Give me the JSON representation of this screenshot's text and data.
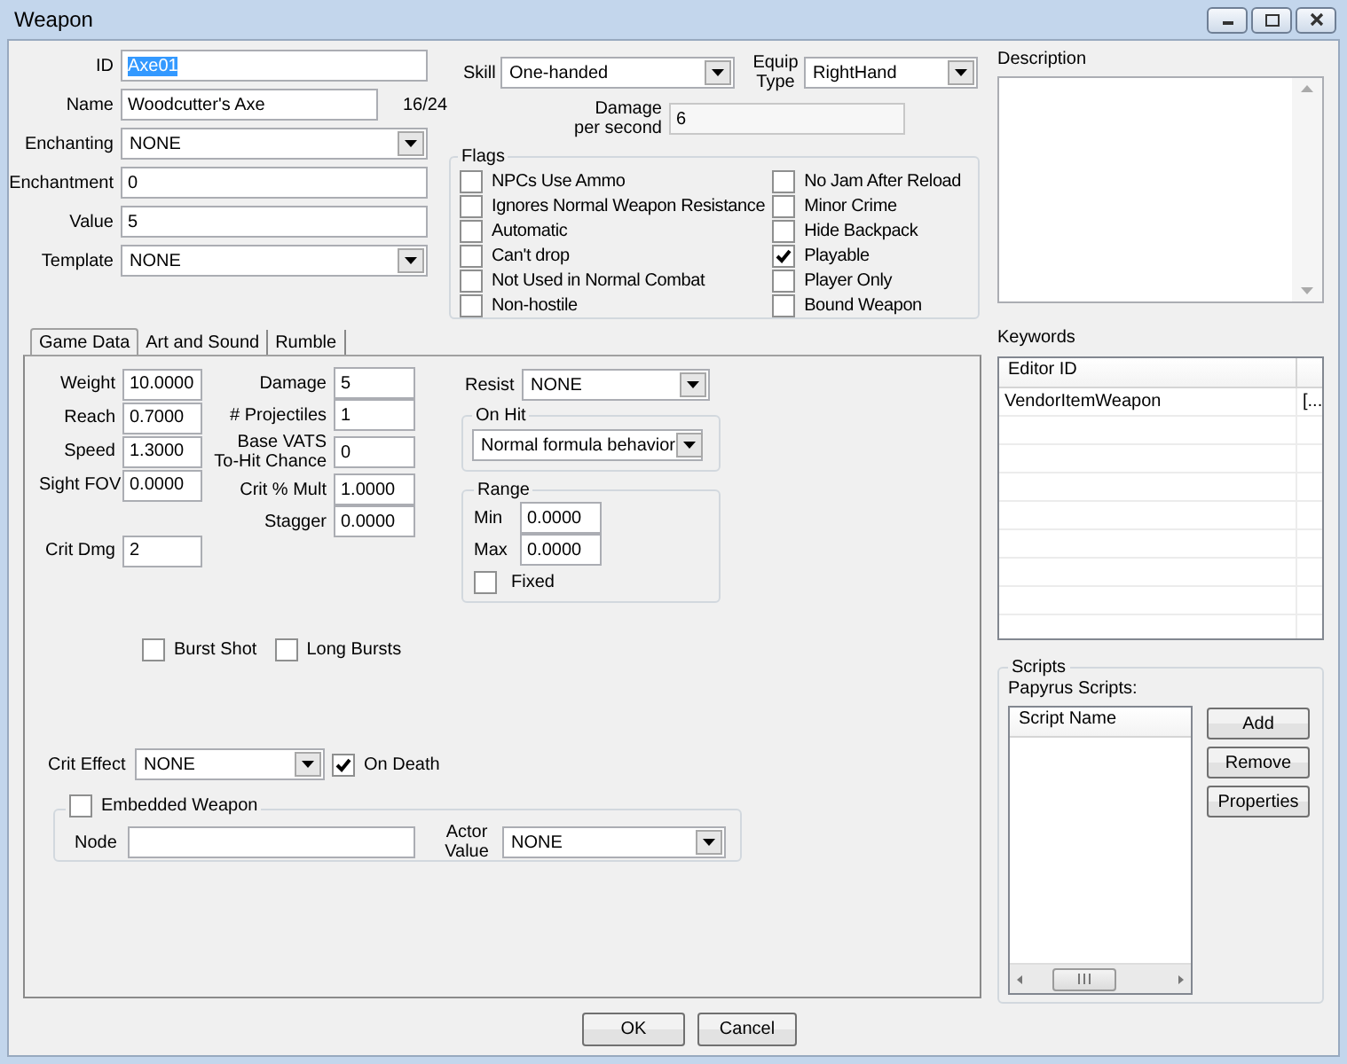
{
  "window": {
    "title": "Weapon"
  },
  "general_fields": [
    {
      "kind": "text",
      "label": "ID",
      "value": "Axe01",
      "highlighted": true
    },
    {
      "kind": "text",
      "label": "Name",
      "value": "Woodcutter's Axe",
      "counter": "16/24"
    },
    {
      "kind": "dropdown",
      "label": "Enchanting",
      "value": "NONE"
    },
    {
      "kind": "text",
      "label": "Enchantment",
      "value": "0"
    },
    {
      "kind": "text",
      "label": "Value",
      "value": "5"
    },
    {
      "kind": "dropdown",
      "label": "Template",
      "value": "NONE"
    }
  ],
  "skill": {
    "label": "Skill",
    "value": "One-handed"
  },
  "equip_type": {
    "label": "Equip Type",
    "value": "RightHand"
  },
  "damage_per_second": {
    "label": "Damage per second",
    "value": "6"
  },
  "flags": {
    "title": "Flags",
    "items": [
      {
        "label": "NPCs Use Ammo",
        "checked": false
      },
      {
        "label": "Ignores Normal Weapon Resistance",
        "checked": false
      },
      {
        "label": "Automatic",
        "checked": false
      },
      {
        "label": "Can't drop",
        "checked": false
      },
      {
        "label": "Not Used in Normal Combat",
        "checked": false
      },
      {
        "label": "Non-hostile",
        "checked": false
      },
      {
        "label": "No Jam After Reload",
        "checked": false
      },
      {
        "label": "Minor Crime",
        "checked": false
      },
      {
        "label": "Hide Backpack",
        "checked": false
      },
      {
        "label": "Playable",
        "checked": true
      },
      {
        "label": "Player Only",
        "checked": false
      },
      {
        "label": "Bound Weapon",
        "checked": false
      }
    ]
  },
  "tabs": [
    {
      "label": "Game Data",
      "selected": true
    },
    {
      "label": "Art and Sound",
      "selected": false
    },
    {
      "label": "Rumble",
      "selected": false
    }
  ],
  "game_data": {
    "column_1": [
      {
        "label": "Weight",
        "value": "10.0000"
      },
      {
        "label": "Reach",
        "value": "0.7000"
      },
      {
        "label": "Speed",
        "value": "1.3000"
      },
      {
        "label": "Sight FOV",
        "value": "0.0000"
      }
    ],
    "crit_dmg": {
      "label": "Crit Dmg",
      "value": "2"
    },
    "column_2": [
      {
        "label": "Damage",
        "value": "5"
      },
      {
        "label": "# Projectiles",
        "value": "1"
      },
      {
        "label": "Base VATS To-Hit Chance",
        "value": "0"
      },
      {
        "label": "Crit % Mult",
        "value": "1.0000"
      },
      {
        "label": "Stagger",
        "value": "0.0000"
      }
    ],
    "resist": {
      "label": "Resist",
      "value": "NONE"
    },
    "on_hit": {
      "title": "On Hit",
      "value": "Normal formula behavior"
    },
    "range": {
      "title": "Range",
      "min": {
        "label": "Min",
        "value": "0.0000"
      },
      "max": {
        "label": "Max",
        "value": "0.0000"
      },
      "fixed": {
        "label": "Fixed",
        "checked": false
      }
    },
    "burst_options": [
      {
        "label": "Burst Shot",
        "checked": false
      },
      {
        "label": "Long Bursts",
        "checked": false
      }
    ],
    "crit_effect": {
      "label": "Crit Effect",
      "value": "NONE"
    },
    "on_death": {
      "label": "On Death",
      "checked": true
    },
    "embedded_weapon": {
      "label": "Embedded Weapon",
      "checked": false,
      "node": {
        "label": "Node"
      },
      "actor_value": {
        "label": "Actor Value",
        "value": "NONE"
      }
    }
  },
  "description": {
    "label": "Description"
  },
  "keywords": {
    "label": "Keywords",
    "columns": [
      "Editor ID"
    ],
    "rows": [
      [
        "VendorItemWeapon",
        "[..."
      ]
    ]
  },
  "scripts": {
    "title": "Scripts",
    "label": "Papyrus Scripts:",
    "columns": [
      "Script Name"
    ],
    "buttons": [
      "Add",
      "Remove",
      "Properties"
    ]
  },
  "buttons": [
    "OK",
    "Cancel"
  ]
}
